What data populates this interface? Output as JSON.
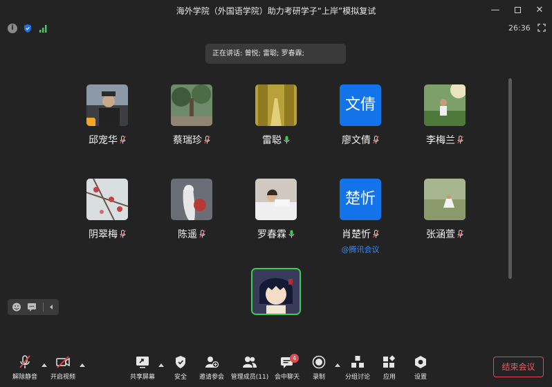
{
  "window": {
    "title": "海外学院（外国语学院）助力考研学子“上岸”模拟复试",
    "minimize": "—",
    "close": "✕"
  },
  "status": {
    "info": "i",
    "timer": "26:36"
  },
  "speaking": {
    "label": "正在讲话:",
    "names": "曾悦; 雷聪; 罗春霖;"
  },
  "participants": [
    {
      "name": "邱宠华",
      "mic": "muted",
      "avatar": "photo"
    },
    {
      "name": "蔡瑞珍",
      "mic": "muted",
      "avatar": "photo"
    },
    {
      "name": "雷聪",
      "mic": "on",
      "avatar": "photo"
    },
    {
      "name": "廖文倩",
      "mic": "muted",
      "avatar": "text",
      "avatar_text": "文倩"
    },
    {
      "name": "李梅兰",
      "mic": "muted",
      "avatar": "photo"
    },
    {
      "name": "阴翠梅",
      "mic": "muted",
      "avatar": "photo"
    },
    {
      "name": "陈遥",
      "mic": "muted",
      "avatar": "photo"
    },
    {
      "name": "罗春霖",
      "mic": "on",
      "avatar": "photo"
    },
    {
      "name": "肖楚忻",
      "mic": "muted",
      "avatar": "text",
      "avatar_text": "楚忻",
      "tag": "@腾讯会议"
    },
    {
      "name": "张涵萱",
      "mic": "muted",
      "avatar": "photo"
    }
  ],
  "toolbar": {
    "unmute": "解除静音",
    "start_video": "开启视频",
    "share_screen": "共享屏幕",
    "security": "安全",
    "invite": "邀请参会",
    "manage_members": "管理成员(11)",
    "chat": "会中聊天",
    "chat_badge": "4",
    "record": "录制",
    "breakout": "分组讨论",
    "apps": "应用",
    "settings": "设置",
    "end_meeting": "结束会议"
  },
  "colors": {
    "background": "#232323",
    "accent_blue": "#1273eb",
    "active_green": "#3dcc54",
    "danger_red": "#e5484d"
  }
}
